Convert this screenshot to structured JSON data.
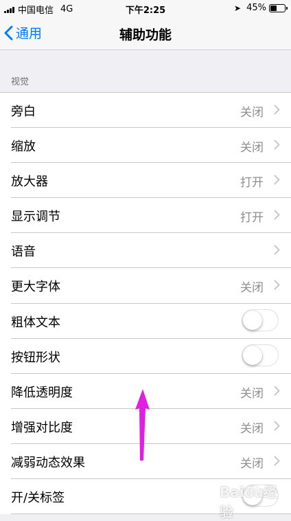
{
  "status_bar": {
    "carrier": "中国电信",
    "network": "4G",
    "time": "下午2:25",
    "battery_percent": "45%",
    "battery_level": 0.45
  },
  "nav": {
    "back_label": "通用",
    "title": "辅助功能"
  },
  "section": {
    "header": "视觉",
    "rows": [
      {
        "label": "旁白",
        "value": "关闭",
        "kind": "disclosure"
      },
      {
        "label": "缩放",
        "value": "关闭",
        "kind": "disclosure"
      },
      {
        "label": "放大器",
        "value": "打开",
        "kind": "disclosure"
      },
      {
        "label": "显示调节",
        "value": "打开",
        "kind": "disclosure"
      },
      {
        "label": "语音",
        "value": "",
        "kind": "disclosure"
      },
      {
        "label": "更大字体",
        "value": "关闭",
        "kind": "disclosure"
      },
      {
        "label": "粗体文本",
        "value": "",
        "kind": "toggle",
        "on": false
      },
      {
        "label": "按钮形状",
        "value": "",
        "kind": "toggle",
        "on": false
      },
      {
        "label": "降低透明度",
        "value": "关闭",
        "kind": "disclosure"
      },
      {
        "label": "增强对比度",
        "value": "关闭",
        "kind": "disclosure"
      },
      {
        "label": "减弱动态效果",
        "value": "关闭",
        "kind": "disclosure"
      },
      {
        "label": "开/关标签",
        "value": "",
        "kind": "toggle",
        "on": false
      }
    ]
  },
  "watermark": "Baidu经验",
  "colors": {
    "accent": "#007aff",
    "annotation_arrow": "#e020e0",
    "background": "#efeff4"
  }
}
